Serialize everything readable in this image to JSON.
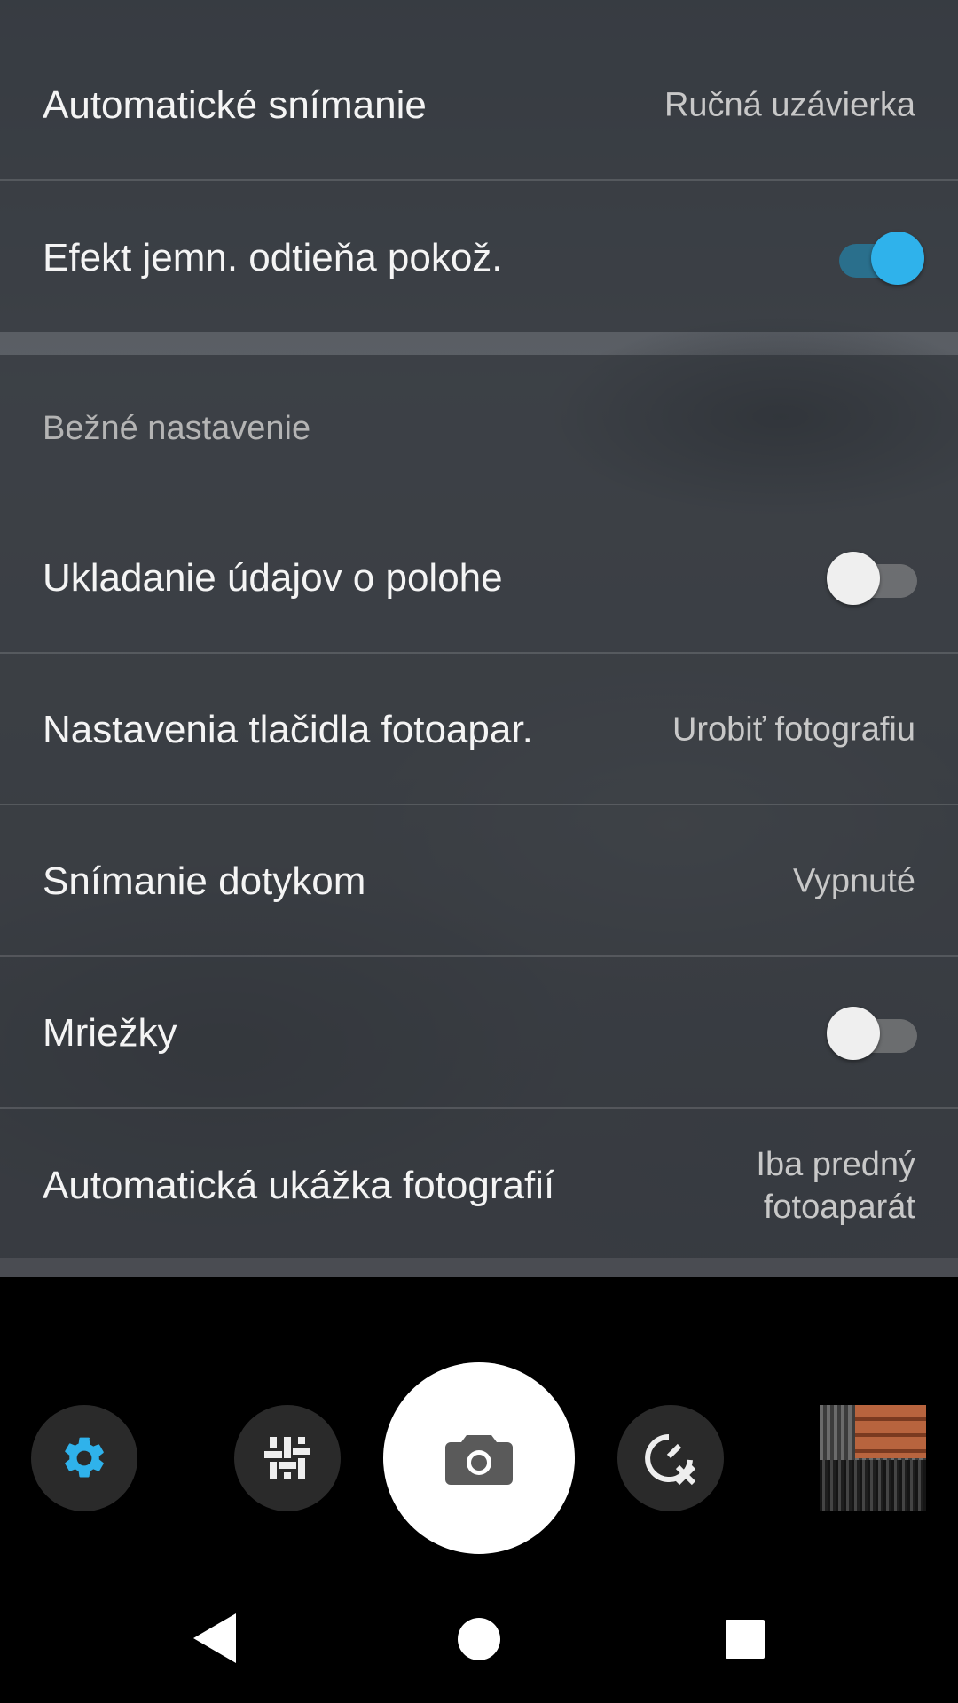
{
  "settings_top": {
    "auto_capture": {
      "label": "Automatické snímanie",
      "value": "Ručná uzávierka"
    },
    "soft_skin": {
      "label": "Efekt jemn. odtieňa pokož.",
      "enabled": true
    }
  },
  "common_section": {
    "header": "Bežné nastavenie",
    "location": {
      "label": "Ukladanie údajov o polohe",
      "enabled": false
    },
    "camera_key": {
      "label": "Nastavenia tlačidla fotoapar.",
      "value": "Urobiť fotografiu"
    },
    "touch_capture": {
      "label": "Snímanie dotykom",
      "value": "Vypnuté"
    },
    "grid": {
      "label": "Mriežky",
      "enabled": false
    },
    "auto_review": {
      "label": "Automatická ukážka fotografií",
      "value_line1": "Iba predný",
      "value_line2": "fotoaparát"
    }
  },
  "camera_controls": {
    "icons": [
      "gear-icon",
      "sliders-icon",
      "camera-icon",
      "timer-off-icon"
    ],
    "settings_active_color": "#2fb2eb"
  },
  "colors": {
    "switch_on_thumb": "#2fb2eb",
    "switch_on_track": "#2a6f8c",
    "switch_off_thumb": "#efefef"
  },
  "navigation": {
    "icons": [
      "back-icon",
      "home-icon",
      "recents-icon"
    ]
  }
}
